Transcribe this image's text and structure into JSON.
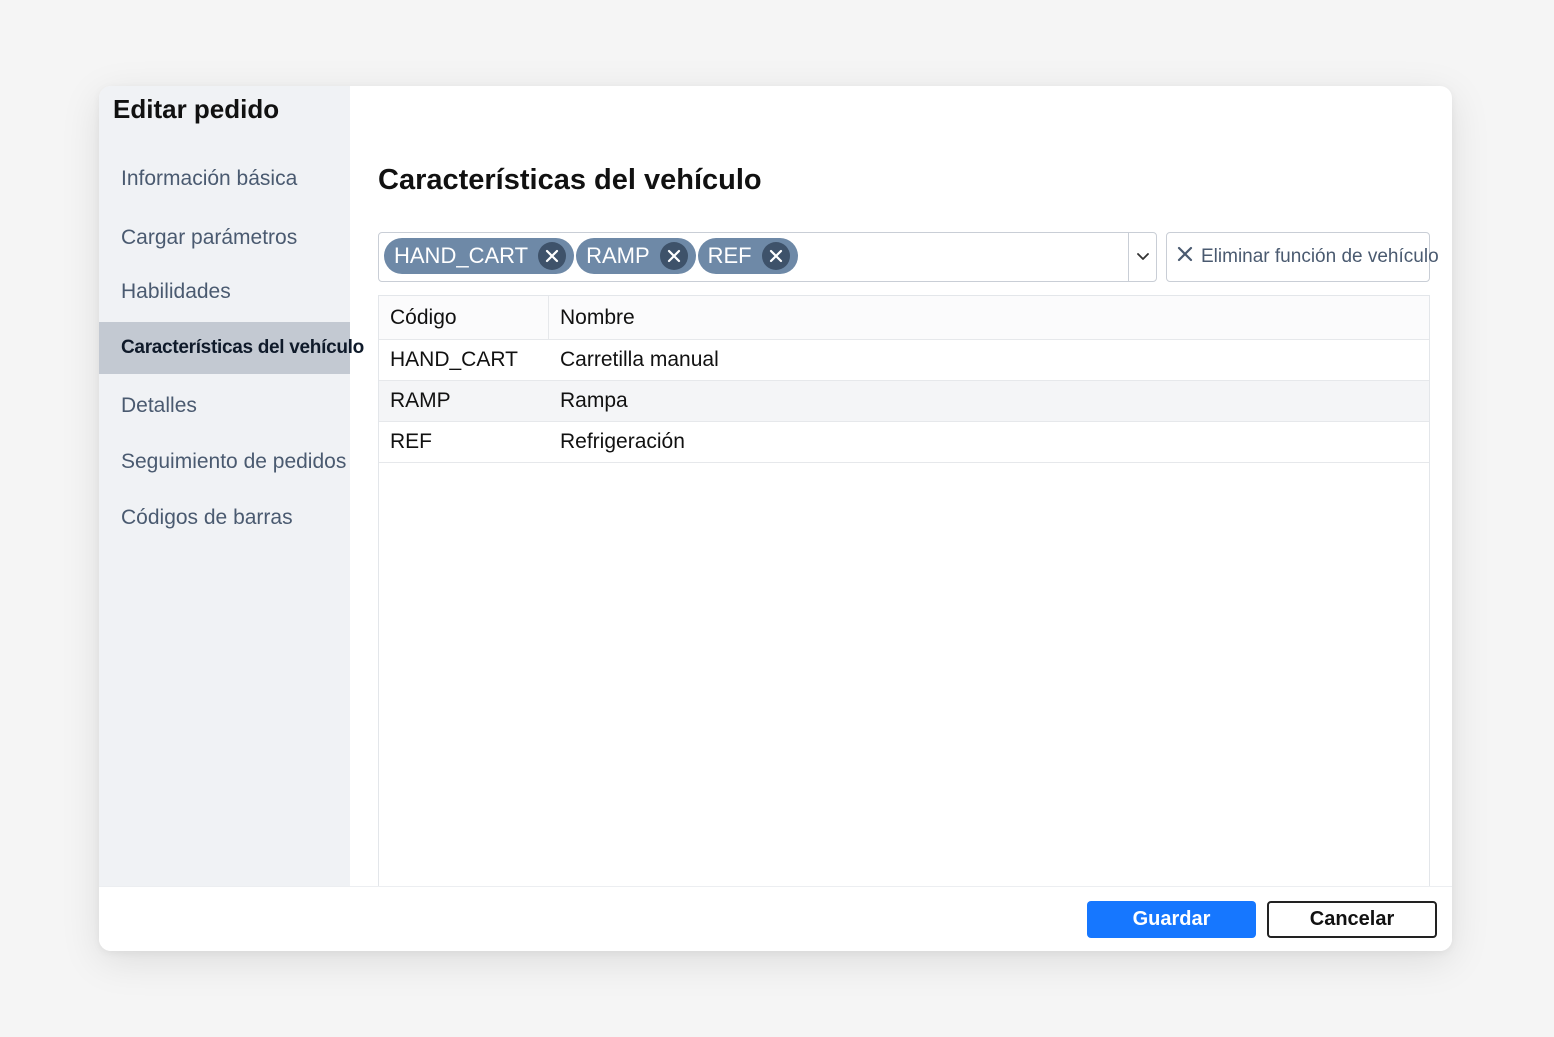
{
  "modal": {
    "title": "Editar pedido"
  },
  "sidebar": {
    "items": [
      {
        "label": "Información básica",
        "active": false
      },
      {
        "label": "Cargar parámetros",
        "active": false
      },
      {
        "label": "Habilidades",
        "active": false
      },
      {
        "label": "Características del vehículo",
        "active": true
      },
      {
        "label": "Detalles",
        "active": false
      },
      {
        "label": "Seguimiento de pedidos",
        "active": false
      },
      {
        "label": "Códigos de barras",
        "active": false
      }
    ]
  },
  "main": {
    "section_title": "Características del vehículo",
    "selected_tags": [
      {
        "label": "HAND_CART",
        "remove_icon": "close-icon"
      },
      {
        "label": "RAMP",
        "remove_icon": "close-icon"
      },
      {
        "label": "REF",
        "remove_icon": "close-icon"
      }
    ],
    "dropdown_icon": "chevron-down-icon",
    "remove_feature_button": {
      "label": "Eliminar función de vehículo",
      "icon": "close-icon"
    },
    "table": {
      "columns": [
        "Código",
        "Nombre"
      ],
      "rows": [
        [
          "HAND_CART",
          "Carretilla manual"
        ],
        [
          "RAMP",
          "Rampa"
        ],
        [
          "REF",
          "Refrigeración"
        ]
      ]
    }
  },
  "footer": {
    "save_label": "Guardar",
    "cancel_label": "Cancelar"
  },
  "colors": {
    "primary": "#1677ff",
    "tag_bg": "#6e89a7",
    "tag_remove_bg": "#3e526a",
    "sidebar_bg": "#f0f2f5",
    "sidebar_active_bg": "#c3c9d2",
    "sidebar_text": "#4a5a70"
  }
}
